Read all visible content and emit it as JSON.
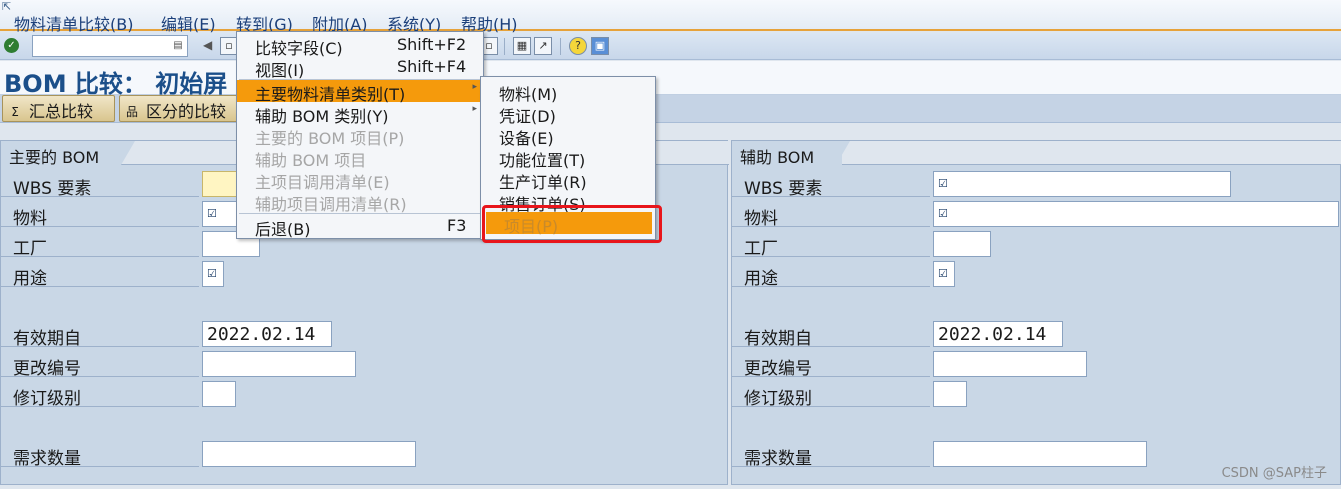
{
  "menubar": {
    "items": [
      "物料清单比较(B)",
      "编辑(E)",
      "转到(G)",
      "附加(A)",
      "系统(Y)",
      "帮助(H)"
    ]
  },
  "toolbar": {
    "command_value": ""
  },
  "title": "BOM 比较： 初始屏",
  "app_toolbar": {
    "summary_compare": "汇总比较",
    "differential_compare": "区分的比较"
  },
  "primary_pane": {
    "header": "主要的 BOM",
    "fields": {
      "wbs": {
        "label": "WBS 要素",
        "value": ""
      },
      "material": {
        "label": "物料",
        "value": ""
      },
      "plant": {
        "label": "工厂",
        "value": ""
      },
      "usage": {
        "label": "用途",
        "value": ""
      },
      "valid_from": {
        "label": "有效期自",
        "value": "2022.02.14"
      },
      "change_number": {
        "label": "更改编号",
        "value": ""
      },
      "revision_level": {
        "label": "修订级别",
        "value": ""
      },
      "required_qty": {
        "label": "需求数量",
        "value": ""
      }
    }
  },
  "secondary_pane": {
    "header": "辅助 BOM",
    "fields": {
      "wbs": {
        "label": "WBS 要素",
        "value": ""
      },
      "material": {
        "label": "物料",
        "value": ""
      },
      "plant": {
        "label": "工厂",
        "value": ""
      },
      "usage": {
        "label": "用途",
        "value": ""
      },
      "valid_from": {
        "label": "有效期自",
        "value": "2022.02.14"
      },
      "change_number": {
        "label": "更改编号",
        "value": ""
      },
      "revision_level": {
        "label": "修订级别",
        "value": ""
      },
      "required_qty": {
        "label": "需求数量",
        "value": ""
      }
    }
  },
  "goto_menu": {
    "items": [
      {
        "label": "比较字段(C)",
        "shortcut": "Shift+F2"
      },
      {
        "label": "视图(I)",
        "shortcut": "Shift+F4"
      },
      {
        "label": "主要物料清单类别(T)",
        "shortcut": ""
      },
      {
        "label": "辅助 BOM 类别(Y)",
        "shortcut": ""
      },
      {
        "label": "主要的 BOM 项目(P)",
        "shortcut": ""
      },
      {
        "label": "辅助 BOM 项目",
        "shortcut": ""
      },
      {
        "label": "主项目调用清单(E)",
        "shortcut": ""
      },
      {
        "label": "辅助项目调用清单(R)",
        "shortcut": ""
      },
      {
        "label": "后退(B)",
        "shortcut": "F3"
      }
    ]
  },
  "category_submenu": {
    "items": [
      "物料(M)",
      "凭证(D)",
      "设备(E)",
      "功能位置(T)",
      "生产订单(R)",
      "销售订单(S)",
      "项目(P)"
    ]
  },
  "watermark": "CSDN @SAP柱子",
  "colors": {
    "highlight": "#f59a0c",
    "annotation_box": "#e8151b",
    "title": "#1b4f8a"
  }
}
